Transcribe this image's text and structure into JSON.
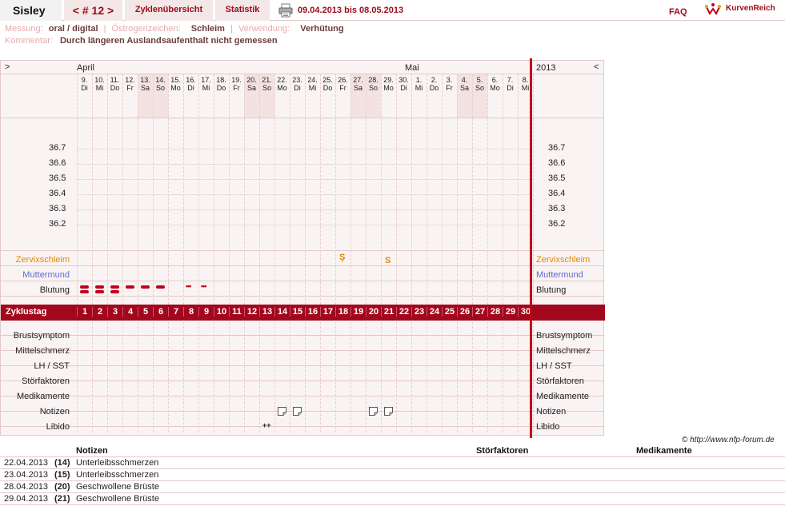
{
  "header": {
    "name": "Sisley",
    "cycle_nav": "< # 12 >",
    "tabs": [
      "Zyklenübersicht",
      "Statistik"
    ],
    "date_range": "09.04.2013 bis 08.05.2013",
    "faq": "FAQ",
    "brand": "KurvenReich"
  },
  "info": {
    "messung_label": "Messung:",
    "messung_value": "oral / digital",
    "oestrogen_label": "Östrogenzeichen:",
    "oestrogen_value": "Schleim",
    "verwendung_label": "Verwendung:",
    "verwendung_value": "Verhütung",
    "kommentar_label": "Kommentar:",
    "kommentar_value": "Durch längeren Auslandsaufenthalt nicht gemessen"
  },
  "chart": {
    "nav_prev": ">",
    "nav_next": "<",
    "month_april": "April",
    "month_mai": "Mai",
    "year": "2013",
    "days": [
      {
        "num": "9.",
        "wd": "Di"
      },
      {
        "num": "10.",
        "wd": "Mi"
      },
      {
        "num": "11.",
        "wd": "Do"
      },
      {
        "num": "12.",
        "wd": "Fr"
      },
      {
        "num": "13.",
        "wd": "Sa"
      },
      {
        "num": "14.",
        "wd": "So"
      },
      {
        "num": "15.",
        "wd": "Mo"
      },
      {
        "num": "16.",
        "wd": "Di"
      },
      {
        "num": "17.",
        "wd": "Mi"
      },
      {
        "num": "18.",
        "wd": "Do"
      },
      {
        "num": "19.",
        "wd": "Fr"
      },
      {
        "num": "20.",
        "wd": "Sa"
      },
      {
        "num": "21.",
        "wd": "So"
      },
      {
        "num": "22.",
        "wd": "Mo"
      },
      {
        "num": "23.",
        "wd": "Di"
      },
      {
        "num": "24.",
        "wd": "Mi"
      },
      {
        "num": "25.",
        "wd": "Do"
      },
      {
        "num": "26.",
        "wd": "Fr"
      },
      {
        "num": "27.",
        "wd": "Sa"
      },
      {
        "num": "28.",
        "wd": "So"
      },
      {
        "num": "29.",
        "wd": "Mo"
      },
      {
        "num": "30.",
        "wd": "Di"
      },
      {
        "num": "1.",
        "wd": "Mi"
      },
      {
        "num": "2.",
        "wd": "Do"
      },
      {
        "num": "3.",
        "wd": "Fr"
      },
      {
        "num": "4.",
        "wd": "Sa"
      },
      {
        "num": "5.",
        "wd": "So"
      },
      {
        "num": "6.",
        "wd": "Mo"
      },
      {
        "num": "7.",
        "wd": "Di"
      },
      {
        "num": "8.",
        "wd": "Mi"
      }
    ],
    "weekend_days": [
      4,
      5,
      11,
      12,
      18,
      19,
      25,
      26
    ],
    "temp_ticks": [
      "36.7",
      "36.6",
      "36.5",
      "36.4",
      "36.3",
      "36.2"
    ],
    "rows_upper": [
      "Zervixschleim",
      "Muttermund",
      "Blutung"
    ],
    "cycle_label": "Zyklustag",
    "cycle_days": [
      "1",
      "2",
      "3",
      "4",
      "5",
      "6",
      "7",
      "8",
      "9",
      "10",
      "11",
      "12",
      "13",
      "14",
      "15",
      "16",
      "17",
      "18",
      "19",
      "20",
      "21",
      "22",
      "23",
      "24",
      "25",
      "26",
      "27",
      "28",
      "29",
      "30"
    ],
    "rows_lower": [
      "Brustsymptom",
      "Mittelschmerz",
      "LH / SST",
      "Störfaktoren",
      "Medikamente",
      "Notizen",
      "Libido"
    ],
    "zervix_marks": [
      {
        "day": 18,
        "sym": "S+"
      },
      {
        "day": 21,
        "sym": "S"
      }
    ],
    "bleeding": [
      {
        "day": 1,
        "level": "heavy"
      },
      {
        "day": 2,
        "level": "heavy"
      },
      {
        "day": 3,
        "level": "heavy"
      },
      {
        "day": 4,
        "level": "medium"
      },
      {
        "day": 5,
        "level": "medium"
      },
      {
        "day": 6,
        "level": "medium"
      },
      {
        "day": 8,
        "level": "spotting"
      },
      {
        "day": 9,
        "level": "spotting"
      }
    ],
    "notes_days": [
      14,
      15,
      20,
      21
    ],
    "libido": {
      "day": 13,
      "sym": "++"
    }
  },
  "colors": {
    "accent": "#9b0c1a",
    "cycle_bar": "#a3071d",
    "zervix": "#e08a00",
    "muttermund": "#5a6bd0"
  },
  "copyright": "© http://www.nfp-forum.de",
  "notes_table": {
    "headers": [
      "Notizen",
      "Störfaktoren",
      "Medikamente"
    ],
    "rows": [
      {
        "date": "22.04.2013",
        "cycle": "(14)",
        "text": "Unterleibsschmerzen"
      },
      {
        "date": "23.04.2013",
        "cycle": "(15)",
        "text": "Unterleibsschmerzen"
      },
      {
        "date": "28.04.2013",
        "cycle": "(20)",
        "text": "Geschwollene Brüste"
      },
      {
        "date": "29.04.2013",
        "cycle": "(21)",
        "text": "Geschwollene Brüste"
      }
    ]
  }
}
